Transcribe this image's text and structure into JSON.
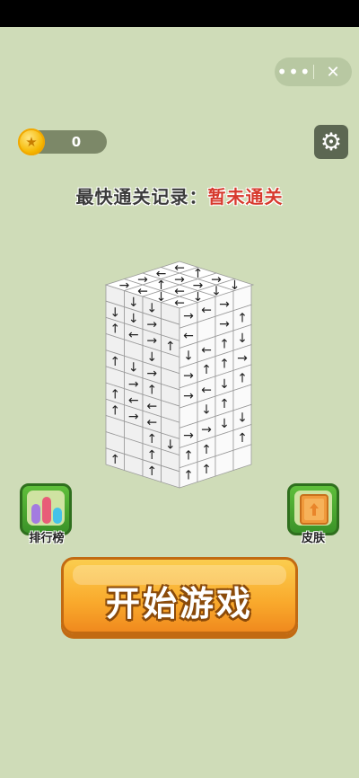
{
  "menu_capsule": {
    "more_icon": "ellipsis-icon",
    "close_icon": "close-icon",
    "more_glyph": "•••",
    "close_glyph": "✕"
  },
  "coins": {
    "count": "0",
    "icon": "coin-icon"
  },
  "settings": {
    "icon": "gear-icon",
    "glyph": "⚙"
  },
  "record": {
    "label": "最快通关记录：",
    "value": "暂未通关"
  },
  "leaderboard": {
    "label": "排行榜",
    "icon": "bar-chart-icon"
  },
  "skin": {
    "label": "皮肤",
    "icon": "crate-icon"
  },
  "start": {
    "label": "开始游戏"
  },
  "puzzle": {
    "top_arrows": [
      "→",
      "←",
      "↓",
      "←",
      "→",
      "↑",
      "←",
      "↓",
      "←",
      "→",
      "→",
      "↓",
      "←",
      "↑",
      "→",
      "↓"
    ],
    "left_arrows": [
      "",
      "↓",
      "↓",
      "",
      "↓",
      "↓",
      "→",
      "",
      "↑",
      "←",
      "→",
      "↑",
      "",
      "",
      "↓",
      "",
      "↑",
      "↓",
      "→",
      "",
      "",
      "→",
      "↑",
      "",
      "↑",
      "←",
      "←",
      "",
      "↑",
      "→",
      "←",
      "",
      "",
      "",
      "↑",
      "↓",
      "",
      "",
      "↑",
      "",
      "↑",
      "",
      "↑",
      ""
    ],
    "right_arrows": [
      "→",
      "←",
      "→",
      "",
      "←",
      "",
      "→",
      "↑",
      "↓",
      "←",
      "↑",
      "↓",
      "→",
      "↑",
      "↑",
      "→",
      "→",
      "←",
      "↓",
      "↑",
      "",
      "↓",
      "↑",
      "",
      "→",
      "→",
      "↓",
      "↓",
      "↑",
      "↑",
      "",
      "↑",
      "↑",
      "↑",
      "",
      ""
    ]
  }
}
